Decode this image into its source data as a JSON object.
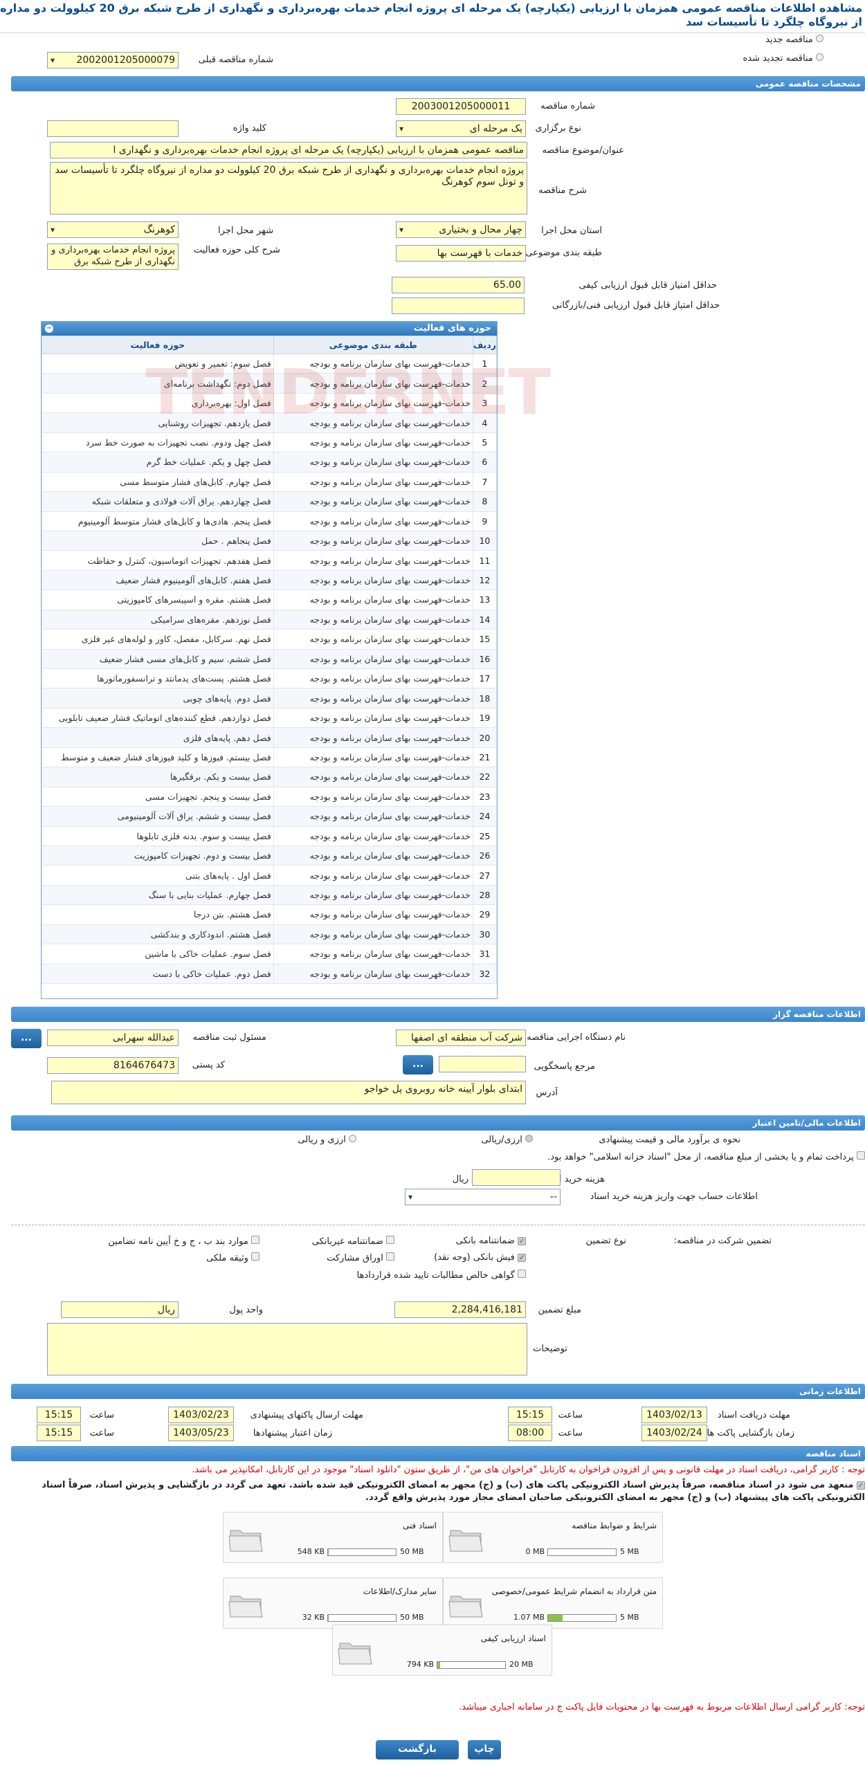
{
  "title": "مشاهده اطلاعات مناقصه عمومی همزمان با ارزیابی (یکپارچه) یک مرحله ای پروژه انجام خدمات بهره‌برداری و نگهداری از طرح شبکه برق 20 کیلوولت دو مداره از نیروگاه چلگرد تا تأسیسات سد",
  "top": {
    "new_label": "مناقصه جدید",
    "renewed_label": "مناقصه تجدید شده",
    "prev_no_label": "شماره مناقصه قبلی",
    "prev_no": "2002001205000079"
  },
  "sections": {
    "general": "مشخصات مناقصه عمومی",
    "organizer": "اطلاعات مناقصه گزار",
    "finance": "اطلاعات مالی/تامین اعتبار",
    "timing": "اطلاعات زمانی",
    "docs": "اسناد مناقصه"
  },
  "general": {
    "no_label": "شماره مناقصه",
    "no": "2003001205000011",
    "type_label": "نوع برگزاری",
    "type": "یک مرحله ای",
    "keyword_label": "کلید واژه",
    "keyword": "",
    "subject_label": "عنوان/موضوع مناقصه",
    "subject": "مناقصه عمومی همزمان با ارزیابی (یکپارچه) یک مرحله ای پروژه انجام خدمات بهره‌برداری و نگهداری ا",
    "desc_label": "شرح مناقصه",
    "desc": "پروژه انجام خدمات بهره‌برداری و نگهداری از طرح شبکه برق 20 کیلوولت دو مداره از نیروگاه چلگرد تا تأسیسات سد و تونل سوم کوهرنگ",
    "province_label": "استان محل اجرا",
    "province": "چهار محال و بختیاری",
    "city_label": "شهر محل اجرا",
    "city": "کوهرنگ",
    "category_label": "طبقه بندی موضوعی",
    "category": "خدمات با فهرست بها",
    "scope_label": "شرح کلی حوزه فعالیت",
    "scope": "پروژه انجام خدمات بهره‌برداری و نگهداری از طرح شبکه برق",
    "min_quality_label": "حداقل امتیاز قابل قبول ارزیابی کیفی",
    "min_quality": "65.00",
    "min_tech_label": "حداقل امتیاز قابل قبول ارزیابی فنی/بازرگانی",
    "min_tech": ""
  },
  "activity": {
    "title": "حوزه های فعالیت",
    "headers": [
      "ردیف",
      "طبقه بندی موضوعی",
      "حوزه فعالیت"
    ],
    "rows": [
      [
        "1",
        "خدمات-فهرست بهای سازمان برنامه و بودجه",
        "فصل سوم: تعمیر و تعویض"
      ],
      [
        "2",
        "خدمات-فهرست بهای سازمان برنامه و بودجه",
        "فصل دوم: نگهداشت برنامه‌ای"
      ],
      [
        "3",
        "خدمات-فهرست بهای سازمان برنامه و بودجه",
        "فصل اول: بهره‌برداری"
      ],
      [
        "4",
        "خدمات-فهرست بهای سازمان برنامه و بودجه",
        "فصل یازدهم. تجهیزات روشنایی"
      ],
      [
        "5",
        "خدمات-فهرست بهای سازمان برنامه و بودجه",
        "فصل چهل ودوم. نصب تجهیزات به صورت خط سرد"
      ],
      [
        "6",
        "خدمات-فهرست بهای سازمان برنامه و بودجه",
        "فصل چهل و یکم. عملیات خط گرم"
      ],
      [
        "7",
        "خدمات-فهرست بهای سازمان برنامه و بودجه",
        "فصل چهارم. کابل‌های فشار متوسط مسی"
      ],
      [
        "8",
        "خدمات-فهرست بهای سازمان برنامه و بودجه",
        "فصل چهاردهم. یراق آلات فولادی و متعلقات شبکه"
      ],
      [
        "9",
        "خدمات-فهرست بهای سازمان برنامه و بودجه",
        "فصل پنجم. هادی‌ها و کابل‌های فشار متوسط آلومینیوم"
      ],
      [
        "10",
        "خدمات-فهرست بهای سازمان برنامه و بودجه",
        "فصل پنجاهم . حمل"
      ],
      [
        "11",
        "خدمات-فهرست بهای سازمان برنامه و بودجه",
        "فصل هفدهم. تجهیزات اتوماسیون، کنترل و حفاظت"
      ],
      [
        "12",
        "خدمات-فهرست بهای سازمان برنامه و بودجه",
        "فصل هفتم. کابل‌های آلومینیوم فشار ضعیف"
      ],
      [
        "13",
        "خدمات-فهرست بهای سازمان برنامه و بودجه",
        "فصل هشتم. مقره و اسپیسرهای کامپوزیتی"
      ],
      [
        "14",
        "خدمات-فهرست بهای سازمان برنامه و بودجه",
        "فصل نوزدهم. مقره‌های سرامیکی"
      ],
      [
        "15",
        "خدمات-فهرست بهای سازمان برنامه و بودجه",
        "فصل نهم. سرکابل، مفصل، کاور و لوله‌های غیر فلزی"
      ],
      [
        "16",
        "خدمات-فهرست بهای سازمان برنامه و بودجه",
        "فصل ششم. سیم و کابل‌های مسی فشار ضعیف"
      ],
      [
        "17",
        "خدمات-فهرست بهای سازمان برنامه و بودجه",
        "فصل هشتم. پست‌های پدمانتد و ترانسفورماتورها"
      ],
      [
        "18",
        "خدمات-فهرست بهای سازمان برنامه و بودجه",
        "فصل دوم. پایه‌های چوبی"
      ],
      [
        "19",
        "خدمات-فهرست بهای سازمان برنامه و بودجه",
        "فصل دوازدهم. قطع کننده‌های اتوماتیک فشار ضعیف تابلویی"
      ],
      [
        "20",
        "خدمات-فهرست بهای سازمان برنامه و بودجه",
        "فصل دهم. پایه‌های فلزی"
      ],
      [
        "21",
        "خدمات-فهرست بهای سازمان برنامه و بودجه",
        "فصل بیستم. فیوزها و کلید فیوزهای فشار ضعیف و متوسط"
      ],
      [
        "22",
        "خدمات-فهرست بهای سازمان برنامه و بودجه",
        "فصل بیست و یکم. برقگیرها"
      ],
      [
        "23",
        "خدمات-فهرست بهای سازمان برنامه و بودجه",
        "فصل بیست و پنجم. تجهیزات مسی"
      ],
      [
        "24",
        "خدمات-فهرست بهای سازمان برنامه و بودجه",
        "فصل بیست و ششم. یراق آلات آلومینیومی"
      ],
      [
        "25",
        "خدمات-فهرست بهای سازمان برنامه و بودجه",
        "فصل بیست و سوم. بدنه فلزی تابلوها"
      ],
      [
        "26",
        "خدمات-فهرست بهای سازمان برنامه و بودجه",
        "فصل بیست و دوم. تجهیزات کامپوزیت"
      ],
      [
        "27",
        "خدمات-فهرست بهای سازمان برنامه و بودجه",
        "فصل اول . پایه‌های بتنی"
      ],
      [
        "28",
        "خدمات-فهرست بهای سازمان برنامه و بودجه",
        "فصل چهارم. عملیات بنایی با سنگ"
      ],
      [
        "29",
        "خدمات-فهرست بهای سازمان برنامه و بودجه",
        "فصل هشتم. بتن درجا"
      ],
      [
        "30",
        "خدمات-فهرست بهای سازمان برنامه و بودجه",
        "فصل هشتم. اندودکاری و بندکشی"
      ],
      [
        "31",
        "خدمات-فهرست بهای سازمان برنامه و بودجه",
        "فصل سوم. عملیات خاکی با ماشین"
      ],
      [
        "32",
        "خدمات-فهرست بهای سازمان برنامه و بودجه",
        "فصل دوم. عملیات خاکی با دست"
      ]
    ]
  },
  "watermark": "TENDERNET",
  "organizer": {
    "org_label": "نام دستگاه اجرایی مناقصه گزار",
    "org": "شرکت آب منطقه ای اصفها",
    "resp_label": "مسئول ثبت مناقصه",
    "resp": "عبدالله سهرابی",
    "ref_label": "مرجع پاسخگویی",
    "ref": "",
    "postal_label": "کد پستی",
    "postal": "8164676473",
    "addr_label": "آدرس",
    "addr": "ابتدای بلوار آیینه خانه روبروی پل خواجو",
    "more": "..."
  },
  "finance": {
    "pay_label": "نحوه ی برآورد مالی و قیمت پیشنهادی",
    "opt1": "ارزی/ریالی",
    "opt2": "ارزی و ریالی",
    "islamic": "پرداخت تمام و یا بخشی از مبلغ مناقصه، از محل \"اسناد خزانه اسلامی\" خواهد بود.",
    "doc_fee_label": "هزینه خرید اسناد",
    "doc_fee_unit": "ریال",
    "doc_fee": "",
    "account_label": "اطلاعات حساب جهت واریز هزینه خرید اسناد",
    "account": "--",
    "guar_label": "تضمین شرکت در مناقصه:",
    "guar_type_label": "نوع تضمین",
    "g1": "ضمانتنامه بانکی",
    "g2": "ضمانتنامه غیربانکی",
    "g3": "موارد بند ب ، ج و خ آیین نامه تضامین",
    "g4": "فیش بانکی (وجه نقد)",
    "g5": "اوراق مشارکت",
    "g6": "وثیقه ملکی",
    "g7": "گواهی خالص مطالبات تایید شده قراردادها",
    "amount_label": "مبلغ تضمین",
    "amount": "2,284,416,181",
    "currency_label": "واحد پول",
    "currency": "ریال",
    "notes_label": "توضیحات",
    "notes": ""
  },
  "timing": {
    "recv_label": "مهلت دریافت اسناد",
    "recv_date": "1403/02/13",
    "recv_time": "15:15",
    "send_label": "مهلت ارسال پاکتهای پیشنهادی",
    "send_date": "1403/02/23",
    "send_time": "15:15",
    "open_label": "زمان بازگشایی پاکت ها",
    "open_date": "1403/02/24",
    "open_time": "08:00",
    "valid_label": "زمان اعتبار پیشنهادها",
    "valid_date": "1403/05/23",
    "valid_time": "15:15",
    "time_label": "ساعت"
  },
  "docs": {
    "note1": "توجه : کاربر گرامی، دریافت اسناد در مهلت قانونی و پس از افزودن فراخوان به کارتابل \"فراخوان های من\"، از طریق ستون \"دانلود اسناد\" موجود در این کارتابل، امکانپذیر می باشد.",
    "note2": "منعهد می شود در اسناد مناقصه، صرفاً پذیرش اسناد الکترونیکی پاکت های (ب) و (ج) مجهر به امضای الکترونیکی قید شده باشد. تعهد می گردد در بازگشایی و پذیرش اسناد، صرفاً اسناد الکترونیکی پاکت های پیشنهاد (ب) و (ج) مجهر به امضای الکترونیکی صاحبان امضای مجاز مورد پذیرش واقع گردد.",
    "files": [
      {
        "name": "شرایط و ضوابط مناقصه",
        "size": "0 MB",
        "max": "5 MB",
        "fill": 0
      },
      {
        "name": "اسناد فنی",
        "size": "548 KB",
        "max": "50 MB",
        "fill": 0.01
      },
      {
        "name": "متن قرارداد به انضمام شرایط عمومی/خصوصی",
        "size": "1.07 MB",
        "max": "5 MB",
        "fill": 0.21
      },
      {
        "name": "سایر مدارک/اطلاعات",
        "size": "32 KB",
        "max": "50 MB",
        "fill": 0.01
      },
      {
        "name": "اسناد ارزیابی کیفی",
        "size": "794 KB",
        "max": "20 MB",
        "fill": 0.04
      }
    ],
    "note3": "توجه: کاربر گرامی ارسال اطلاعات مربوط به فهرست بها در محتویات فایل پاکت ج در سامانه اجباری میباشد."
  },
  "buttons": {
    "print": "چاپ",
    "back": "بازگشت"
  }
}
